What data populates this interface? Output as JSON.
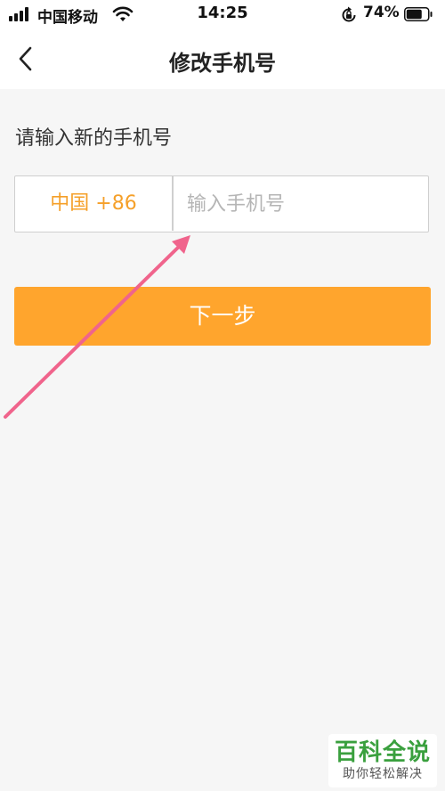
{
  "status_bar": {
    "carrier": "中国移动",
    "time": "14:25",
    "battery_percent": "74%",
    "battery_level": 0.74,
    "icons": [
      "signal-icon",
      "wifi-icon",
      "rotation-lock-icon",
      "battery-icon"
    ]
  },
  "nav": {
    "back_icon": "chevron-left-icon",
    "title": "修改手机号"
  },
  "form": {
    "prompt": "请输入新的手机号",
    "country_code": "中国 +86",
    "phone_placeholder": "输入手机号",
    "phone_value": ""
  },
  "actions": {
    "next_label": "下一步"
  },
  "watermark": {
    "title": "百科全说",
    "subtitle": "助你轻松解决"
  },
  "colors": {
    "accent": "#ffa52d",
    "country_text": "#f5a02a",
    "annotation_arrow": "#f0648c",
    "watermark_green": "#3aa03e"
  }
}
